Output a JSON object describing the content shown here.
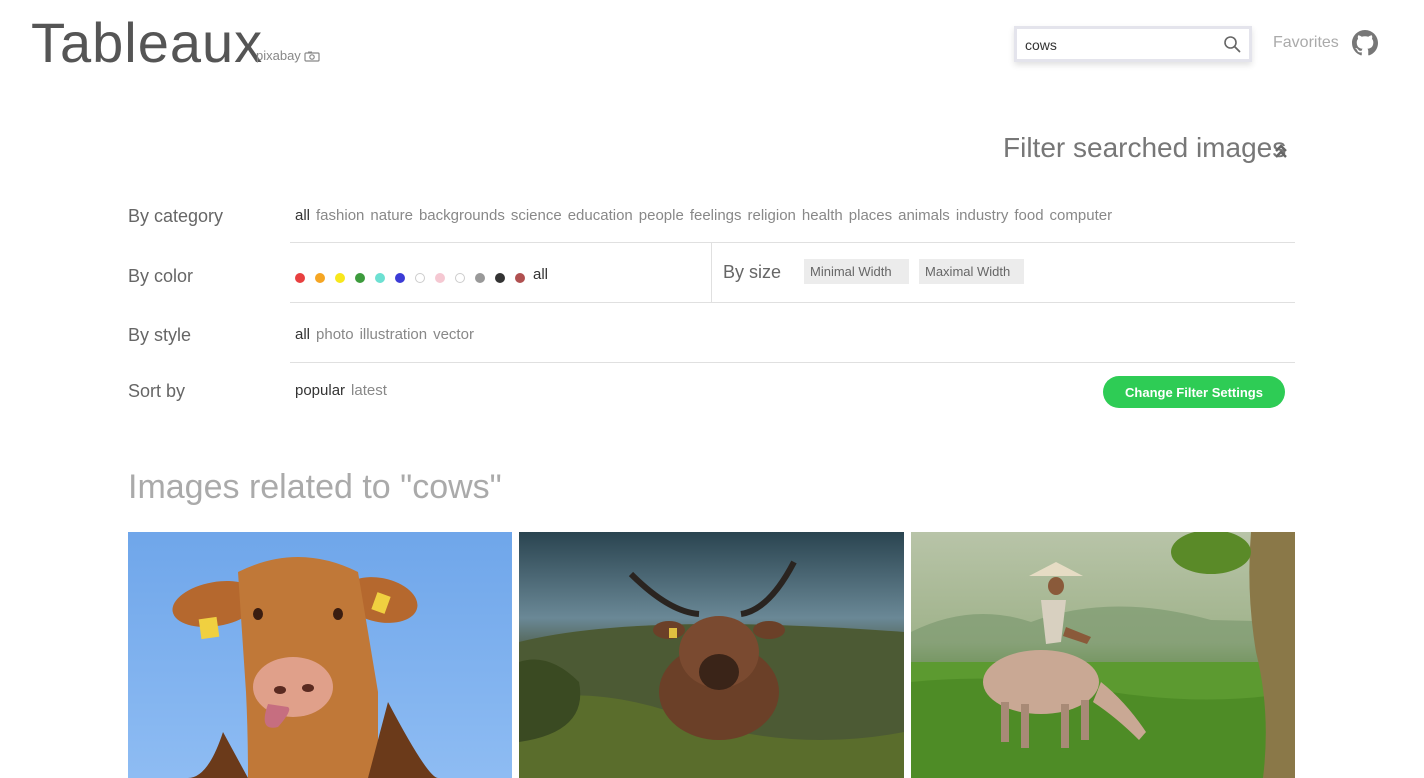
{
  "header": {
    "logo": "Tableaux",
    "logo_sub": "pixabay",
    "search_value": "cows",
    "favorites": "Favorites"
  },
  "filter": {
    "title": "Filter searched images",
    "category": {
      "label": "By category",
      "items": [
        "all",
        "fashion",
        "nature",
        "backgrounds",
        "science",
        "education",
        "people",
        "feelings",
        "religion",
        "health",
        "places",
        "animals",
        "industry",
        "food",
        "computer"
      ],
      "active": "all"
    },
    "color": {
      "label": "By color",
      "colors": [
        "#e84040",
        "#f5a623",
        "#f8e71c",
        "#3d9b3d",
        "#6de0d2",
        "#3b3bd6",
        "#ffffff",
        "#f5c8d2",
        "#ffffff",
        "#999999",
        "#333333",
        "#b05050"
      ],
      "all": "all"
    },
    "size": {
      "label": "By size",
      "min_placeholder": "Minimal Width",
      "max_placeholder": "Maximal Width"
    },
    "style": {
      "label": "By style",
      "items": [
        "all",
        "photo",
        "illustration",
        "vector"
      ],
      "active": "all"
    },
    "sort": {
      "label": "Sort by",
      "items": [
        "popular",
        "latest"
      ],
      "active": "popular"
    },
    "apply_button": "Change Filter Settings"
  },
  "results": {
    "title": "Images related to \"cows\""
  },
  "icons": {
    "search": "search-icon",
    "github": "github-icon",
    "collapse": "chevron-double-up-icon",
    "logo_mark": "camera-icon"
  }
}
